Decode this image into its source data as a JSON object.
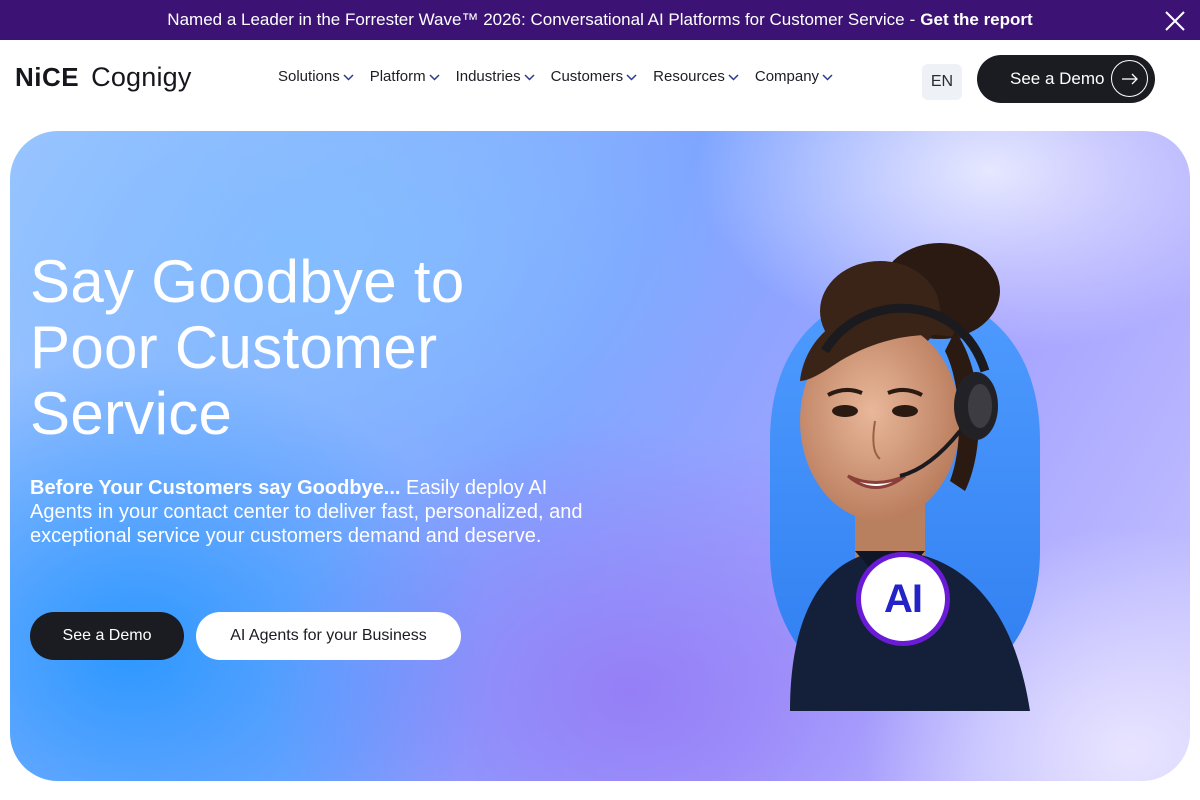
{
  "banner": {
    "text": "Named a Leader in the Forrester Wave™ 2026: Conversational AI Platforms for Customer Service",
    "separator": "-",
    "cta": "Get the report",
    "close_icon": "close-icon"
  },
  "header": {
    "logo_nice": "NiCE",
    "logo_cognigy": "Cognigy",
    "nav": [
      {
        "label": "Solutions"
      },
      {
        "label": "Platform"
      },
      {
        "label": "Industries"
      },
      {
        "label": "Customers"
      },
      {
        "label": "Resources"
      },
      {
        "label": "Company"
      }
    ],
    "language": "EN",
    "demo_button": "See a Demo",
    "demo_icon": "arrow-right-icon"
  },
  "hero": {
    "title": "Say Goodbye to Poor Customer Service",
    "subtitle_bold": "Before Your Customers say Goodbye...",
    "subtitle_rest": " Easily deploy AI Agents in your contact center to deliver fast, personalized, and exceptional service your customers demand and deserve.",
    "primary_button": "See a Demo",
    "secondary_button": "AI Agents for your Business",
    "badge_text": "AI"
  },
  "colors": {
    "banner_bg": "#3c1375",
    "dark_button": "#1b1b22",
    "badge_ring": "#6a1bd6",
    "badge_text": "#2323c8"
  }
}
